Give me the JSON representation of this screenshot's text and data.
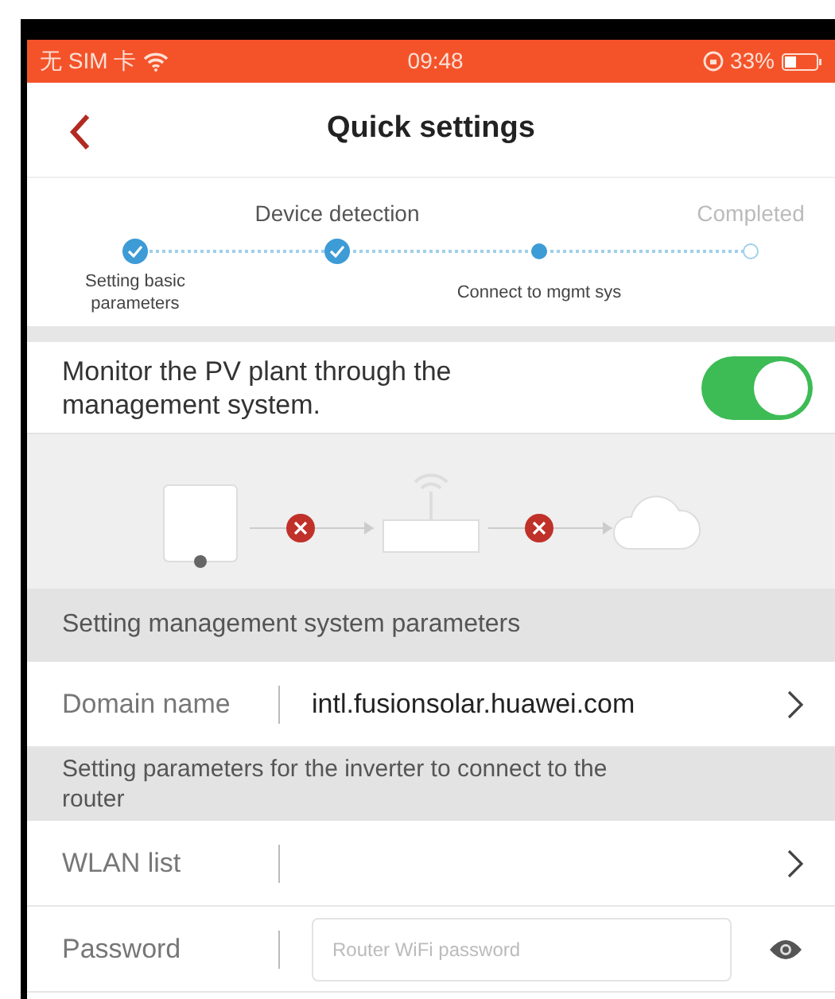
{
  "status_bar": {
    "carrier": "无 SIM 卡",
    "time": "09:48",
    "battery": "33%"
  },
  "header": {
    "title": "Quick settings"
  },
  "stepper": {
    "steps": [
      {
        "label": "Setting basic parameters",
        "label_above": false,
        "completed": true,
        "current": false
      },
      {
        "label": "Device detection",
        "label_above": true,
        "completed": true,
        "current": false
      },
      {
        "label": "Connect to mgmt sys",
        "label_above": false,
        "completed": false,
        "current": true
      },
      {
        "label": "Completed",
        "label_above": true,
        "completed": false,
        "current": false
      }
    ]
  },
  "monitor": {
    "label": "Monitor the PV plant through the management system.",
    "on": true
  },
  "diagram": {
    "links": [
      {
        "connected": false
      },
      {
        "connected": false
      }
    ]
  },
  "sections": [
    {
      "title": "Setting management system parameters",
      "rows": [
        {
          "kind": "select",
          "label": "Domain name",
          "value": "intl.fusionsolar.huawei.com"
        }
      ]
    },
    {
      "title": "Setting parameters for the inverter to connect to the router",
      "rows": [
        {
          "kind": "select",
          "label": "WLAN list"
        },
        {
          "kind": "password",
          "label": "Password",
          "placeholder": "Router WiFi password"
        }
      ]
    }
  ]
}
